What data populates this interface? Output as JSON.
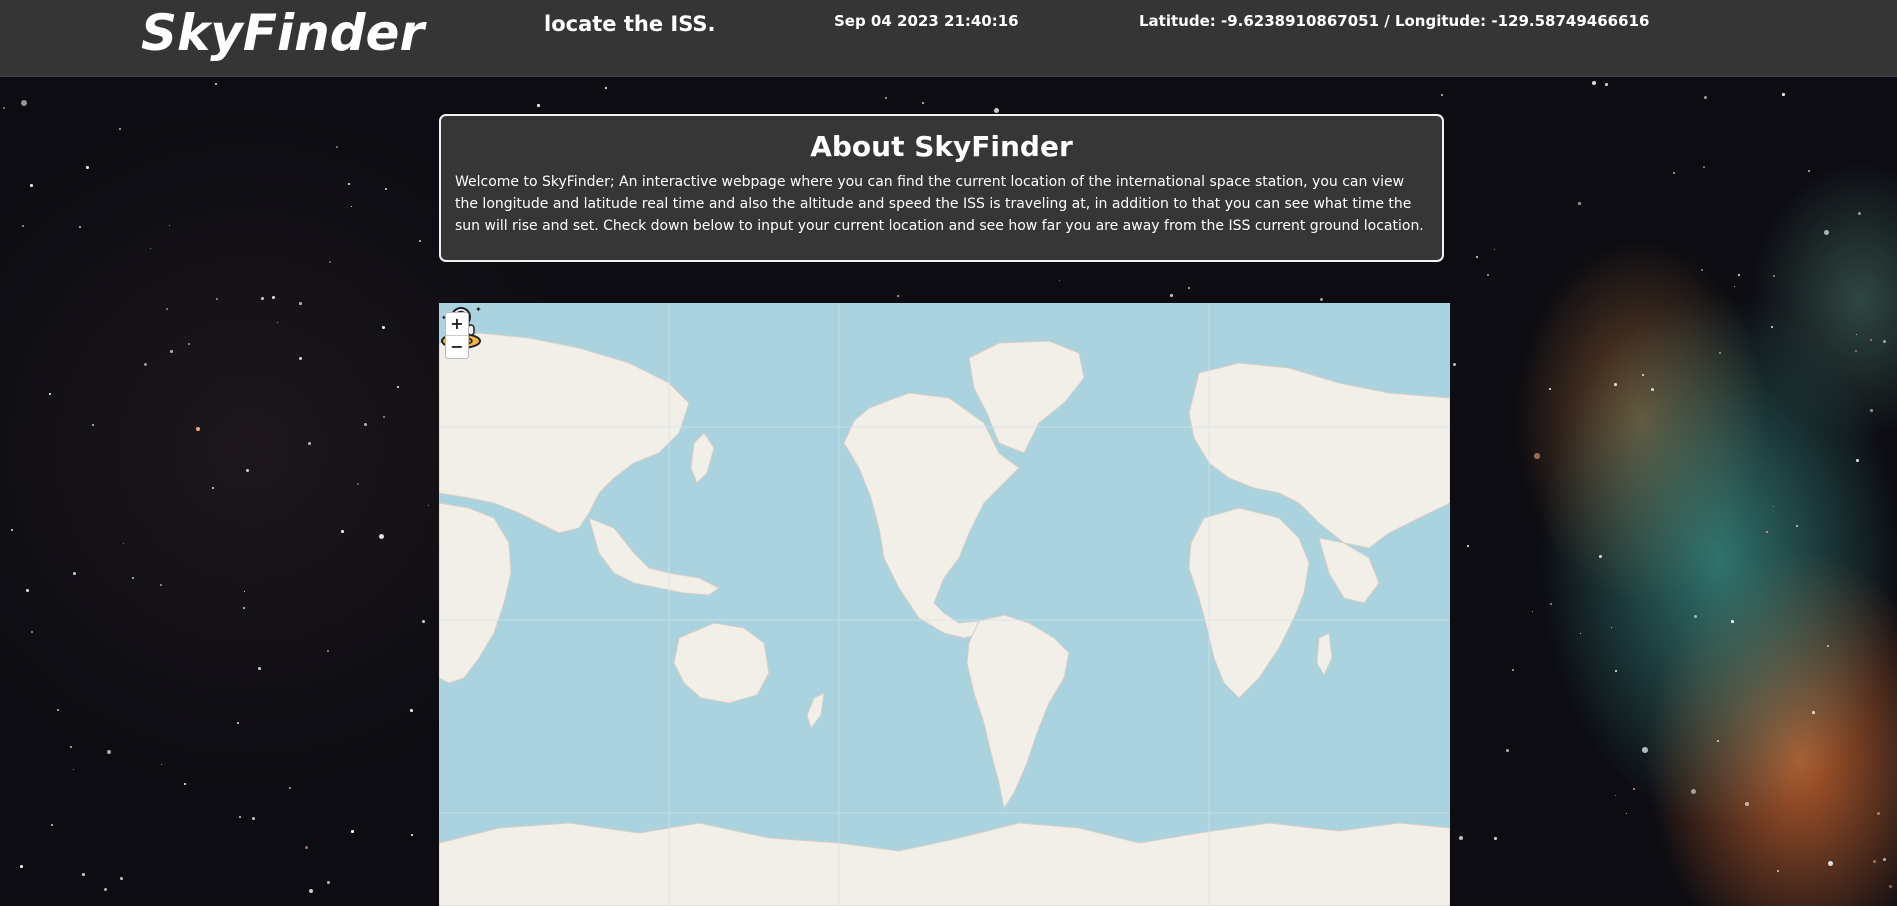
{
  "header": {
    "brand": "SkyFinder",
    "tagline": "locate the ISS.",
    "datetime": "Sep 04 2023 21:40:16",
    "coords": "Latitude: -9.6238910867051 / Longitude: -129.58749466616"
  },
  "about": {
    "title": "About SkyFinder",
    "body": "Welcome to SkyFinder; An interactive webpage where you can find the current location of the international space station, you can view the longitude and latitude real time and also the altitude and speed the ISS is traveling at, in addition to that you can see what time the sun will rise and set. Check down below to input your current location and see how far you are away from the ISS current ground location."
  },
  "map": {
    "zoom_in_label": "+",
    "zoom_out_label": "−",
    "ocean_color": "#aad3df",
    "land_color": "#f2efe9",
    "marker_icon": "astronaut-icon"
  }
}
